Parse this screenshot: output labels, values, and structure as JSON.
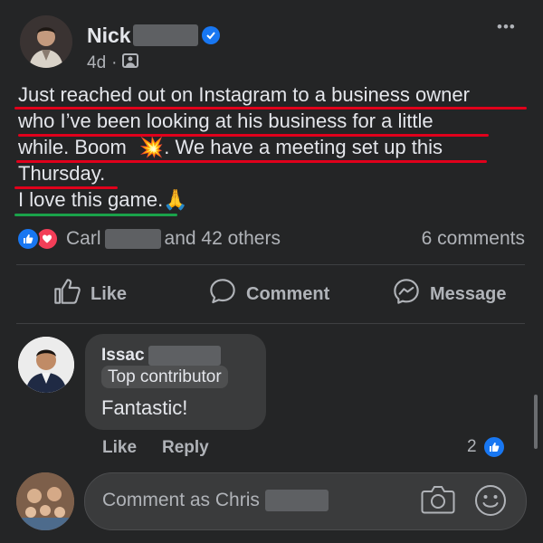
{
  "post": {
    "author_name": "Nick",
    "age": "4d",
    "separator": "·",
    "menu_glyph": "•••",
    "text_line_1": "Just reached out on Instagram to a business owner",
    "text_line_2": "who I’ve been looking at his business for a little",
    "text_line_3a": "while. Boom",
    "text_line_3_emoji": "💥",
    "text_line_3b": ". We have a meeting set up this",
    "text_line_4": "Thursday.",
    "text_line_5": "I love this game.",
    "text_line_5_emoji": "🙏",
    "underline_colors": {
      "red": "#e0001b",
      "green": "#1aa24a"
    }
  },
  "reactions": {
    "reactor_name": "Carl",
    "others": "and 42 others",
    "comments_count": "6 comments",
    "like_color": "#1877f2",
    "love_color": "#f33e58"
  },
  "actions": {
    "like": "Like",
    "comment": "Comment",
    "message": "Message"
  },
  "comment": {
    "author": "Issac",
    "badge": "Top contributor",
    "text": "Fantastic!",
    "like": "Like",
    "reply": "Reply",
    "reaction_count": "2"
  },
  "composer": {
    "placeholder": "Comment as Chris"
  },
  "icons": [
    "verified-badge-icon",
    "audience-icon",
    "more-options-icon",
    "like-reaction-icon",
    "love-reaction-icon",
    "thumbs-up-icon",
    "comment-icon",
    "messenger-icon",
    "camera-icon",
    "emoji-icon"
  ]
}
